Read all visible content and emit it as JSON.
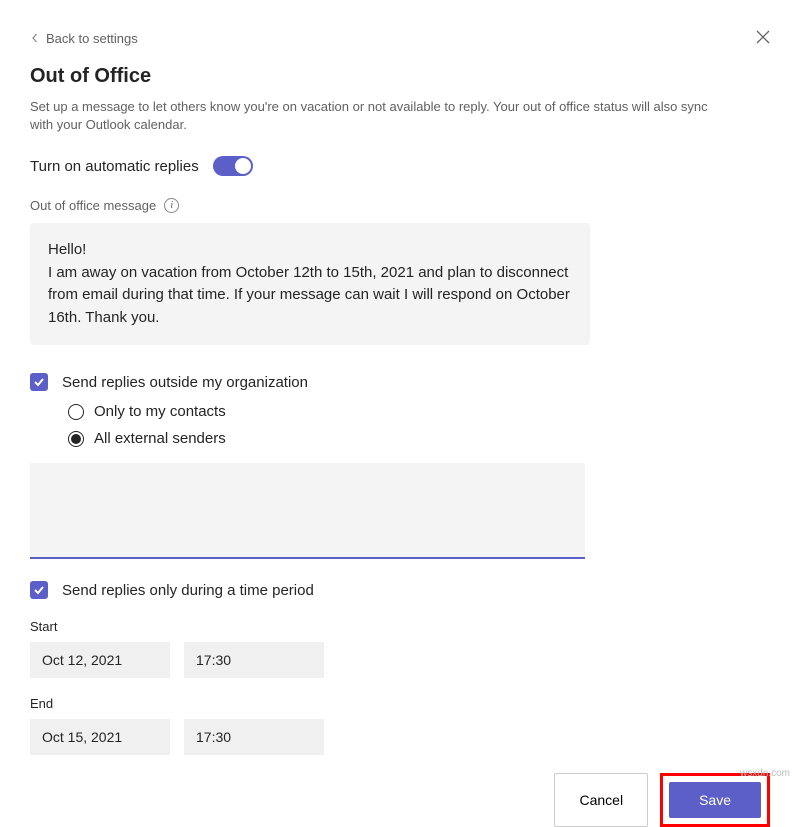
{
  "back_link": "Back to settings",
  "title": "Out of Office",
  "description": "Set up a message to let others know you're on vacation or not available to reply. Your out of office status will also sync with your Outlook calendar.",
  "toggle_label": "Turn on automatic replies",
  "message_section_label": "Out of office message",
  "message_body": "Hello!\nI am away on vacation from October 12th to 15th, 2021 and plan to disconnect from email during that time. If your message can wait I will respond on October 16th. Thank you.",
  "send_outside_label": "Send replies outside my organization",
  "radio_contacts": "Only to my contacts",
  "radio_external": "All external senders",
  "send_period_label": "Send replies only during a time period",
  "start_label": "Start",
  "start_date": "Oct 12, 2021",
  "start_time": "17:30",
  "end_label": "End",
  "end_date": "Oct 15, 2021",
  "end_time": "17:30",
  "cancel_label": "Cancel",
  "save_label": "Save",
  "attribution": "wsxdn.com"
}
